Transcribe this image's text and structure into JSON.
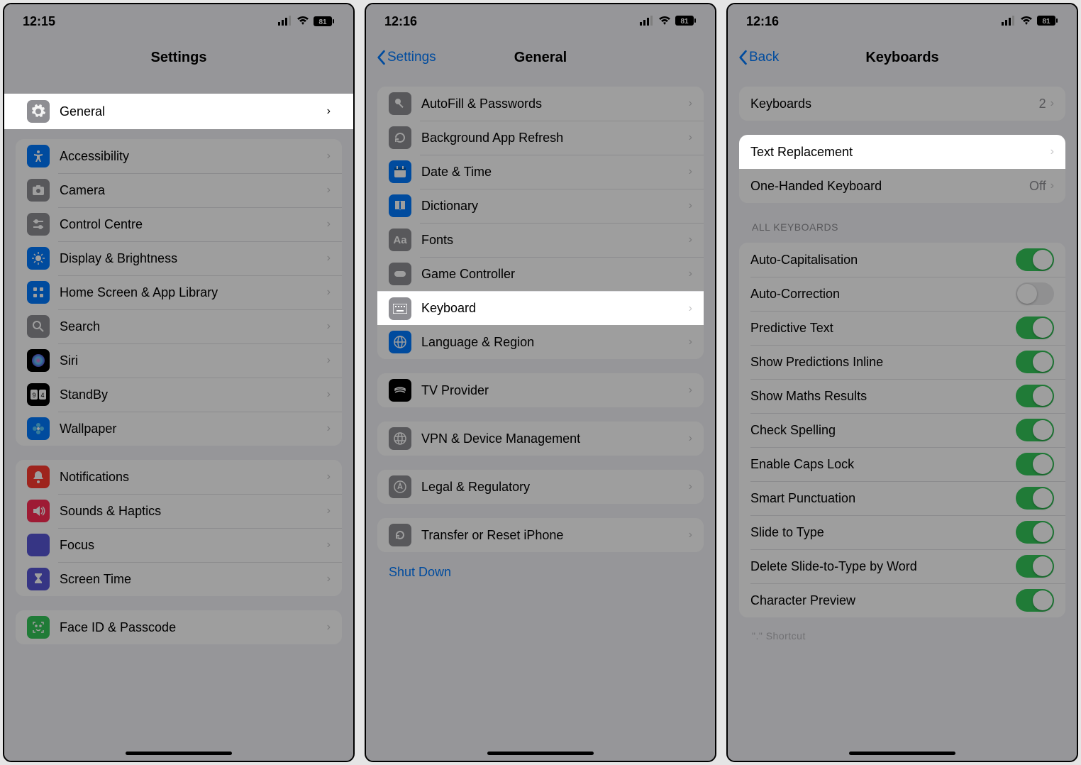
{
  "panel1": {
    "time": "12:15",
    "battery": "81",
    "title": "Settings",
    "highlight": "General",
    "rows": [
      {
        "label": "Accessibility",
        "icon": "accessibility",
        "bg": "bg-blue"
      },
      {
        "label": "Camera",
        "icon": "camera",
        "bg": "bg-gray"
      },
      {
        "label": "Control Centre",
        "icon": "sliders",
        "bg": "bg-gray"
      },
      {
        "label": "Display & Brightness",
        "icon": "sun",
        "bg": "bg-blue"
      },
      {
        "label": "Home Screen & App Library",
        "icon": "grid",
        "bg": "bg-blue"
      },
      {
        "label": "Search",
        "icon": "search",
        "bg": "bg-gray"
      },
      {
        "label": "Siri",
        "icon": "siri",
        "bg": "bg-black"
      },
      {
        "label": "StandBy",
        "icon": "standby",
        "bg": "bg-black"
      },
      {
        "label": "Wallpaper",
        "icon": "flower",
        "bg": "bg-blue"
      }
    ],
    "rows2": [
      {
        "label": "Notifications",
        "icon": "bell",
        "bg": "bg-red"
      },
      {
        "label": "Sounds & Haptics",
        "icon": "speaker",
        "bg": "bg-pink"
      },
      {
        "label": "Focus",
        "icon": "moon",
        "bg": "bg-indigo"
      },
      {
        "label": "Screen Time",
        "icon": "hourglass",
        "bg": "bg-indigo"
      }
    ],
    "rows3": [
      {
        "label": "Face ID & Passcode",
        "icon": "faceid",
        "bg": "bg-green"
      }
    ]
  },
  "panel2": {
    "time": "12:16",
    "battery": "81",
    "backLabel": "Settings",
    "title": "General",
    "rowsA": [
      {
        "label": "AutoFill & Passwords",
        "icon": "key",
        "bg": "bg-gray"
      },
      {
        "label": "Background App Refresh",
        "icon": "refresh",
        "bg": "bg-gray"
      },
      {
        "label": "Date & Time",
        "icon": "calendar",
        "bg": "bg-blue"
      },
      {
        "label": "Dictionary",
        "icon": "book",
        "bg": "bg-blue"
      },
      {
        "label": "Fonts",
        "icon": "fonts",
        "bg": "bg-gray"
      },
      {
        "label": "Game Controller",
        "icon": "game",
        "bg": "bg-gray"
      }
    ],
    "highlight": "Keyboard",
    "rowsA2": [
      {
        "label": "Language & Region",
        "icon": "globe",
        "bg": "bg-blue"
      }
    ],
    "rowsB": [
      {
        "label": "TV Provider",
        "icon": "tv",
        "bg": "bg-black"
      }
    ],
    "rowsC": [
      {
        "label": "VPN & Device Management",
        "icon": "vpn",
        "bg": "bg-gray"
      }
    ],
    "rowsD": [
      {
        "label": "Legal & Regulatory",
        "icon": "legal",
        "bg": "bg-gray"
      }
    ],
    "rowsE": [
      {
        "label": "Transfer or Reset iPhone",
        "icon": "reset",
        "bg": "bg-gray"
      }
    ],
    "shutdown": "Shut Down"
  },
  "panel3": {
    "time": "12:16",
    "battery": "81",
    "backLabel": "Back",
    "title": "Keyboards",
    "row1": {
      "label": "Keyboards",
      "value": "2"
    },
    "highlight": "Text Replacement",
    "row3": {
      "label": "One-Handed Keyboard",
      "value": "Off"
    },
    "groupHeader": "ALL KEYBOARDS",
    "toggles": [
      {
        "label": "Auto-Capitalisation",
        "on": true
      },
      {
        "label": "Auto-Correction",
        "on": false
      },
      {
        "label": "Predictive Text",
        "on": true
      },
      {
        "label": "Show Predictions Inline",
        "on": true
      },
      {
        "label": "Show Maths Results",
        "on": true
      },
      {
        "label": "Check Spelling",
        "on": true
      },
      {
        "label": "Enable Caps Lock",
        "on": true
      },
      {
        "label": "Smart Punctuation",
        "on": true
      },
      {
        "label": "Slide to Type",
        "on": true
      },
      {
        "label": "Delete Slide-to-Type by Word",
        "on": true
      },
      {
        "label": "Character Preview",
        "on": true
      }
    ],
    "shortcut": "\".\" Shortcut"
  }
}
